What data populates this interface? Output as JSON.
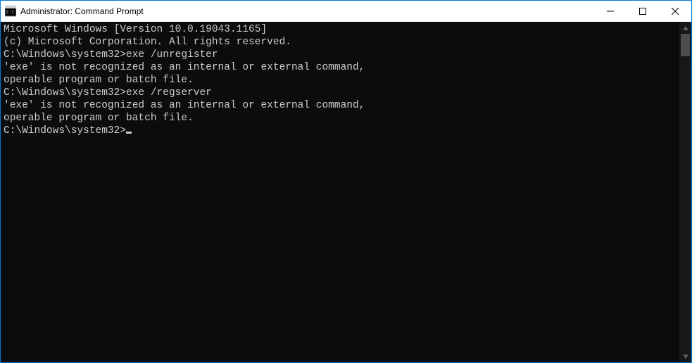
{
  "titlebar": {
    "title": "Administrator: Command Prompt"
  },
  "console": {
    "lines": [
      "Microsoft Windows [Version 10.0.19043.1165]",
      "(c) Microsoft Corporation. All rights reserved.",
      "",
      "C:\\Windows\\system32>exe /unregister",
      "'exe' is not recognized as an internal or external command,",
      "operable program or batch file.",
      "",
      "C:\\Windows\\system32>exe /regserver",
      "'exe' is not recognized as an internal or external command,",
      "operable program or batch file.",
      ""
    ],
    "prompt": "C:\\Windows\\system32>"
  }
}
